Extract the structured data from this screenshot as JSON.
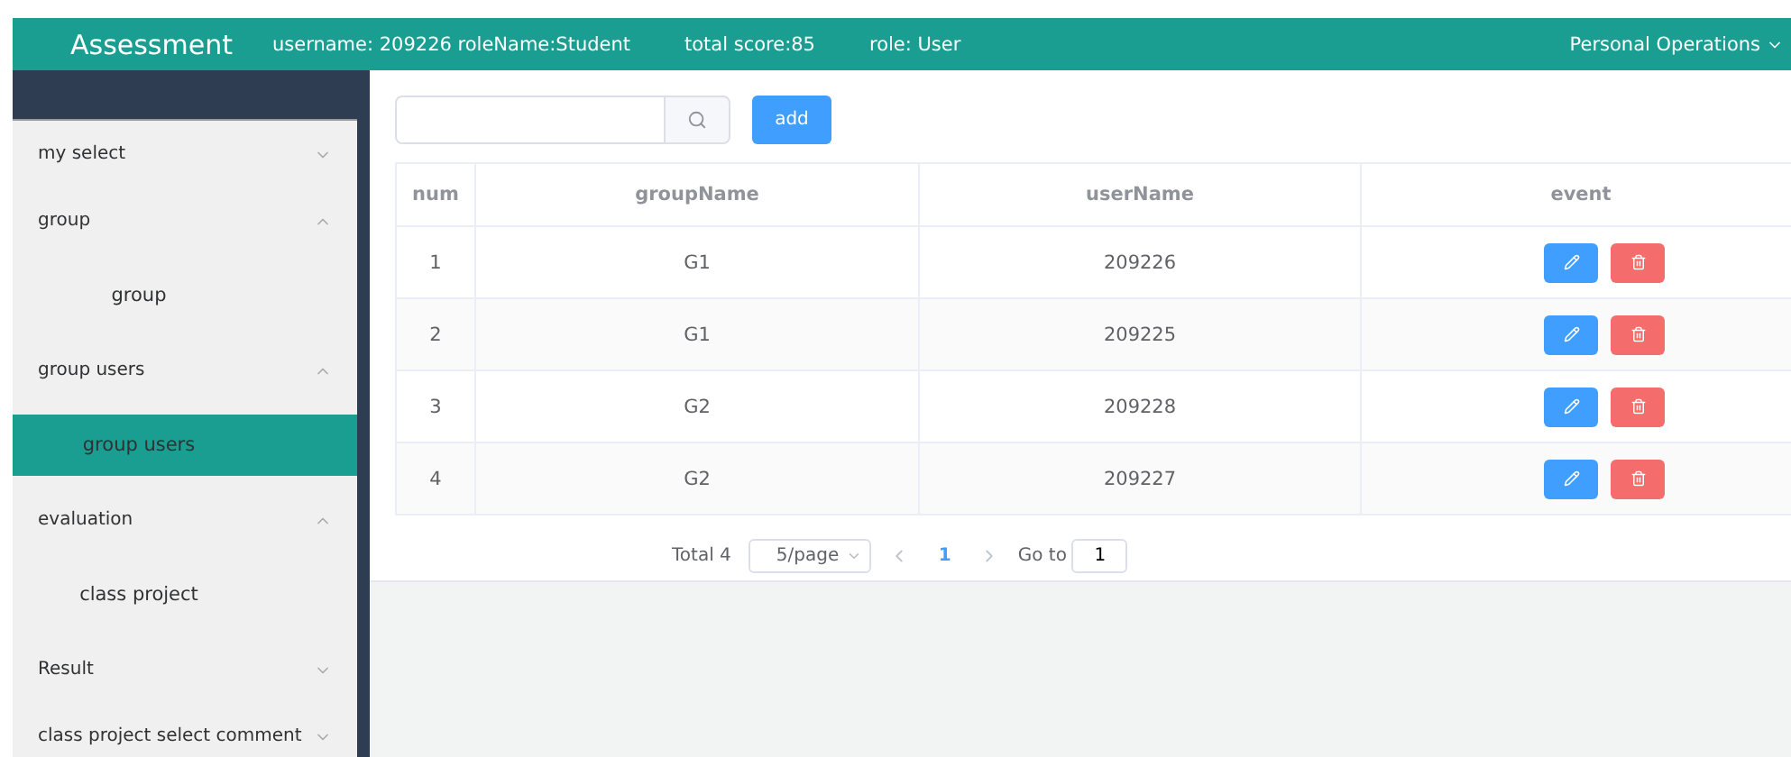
{
  "header": {
    "title": "Assessment",
    "info": [
      "username: 209226 roleName:Student",
      "total score:85",
      "role: User"
    ],
    "menu": "Personal Operations"
  },
  "sidebar": {
    "items": [
      {
        "label": "my select",
        "expanded": false
      },
      {
        "label": "group",
        "expanded": true,
        "children": [
          {
            "label": "group",
            "selected": false
          }
        ]
      },
      {
        "label": "group users",
        "expanded": true,
        "children": [
          {
            "label": "group users",
            "selected": true
          }
        ]
      },
      {
        "label": "evaluation",
        "expanded": true,
        "children": [
          {
            "label": "class project",
            "selected": false
          }
        ]
      },
      {
        "label": "Result",
        "expanded": false
      },
      {
        "label": "class project select comment",
        "expanded": false
      }
    ]
  },
  "toolbar": {
    "add_button": "add"
  },
  "table": {
    "columns": [
      "num",
      "groupName",
      "userName",
      "event"
    ],
    "rows": [
      {
        "num": "1",
        "groupName": "G1",
        "userName": "209226"
      },
      {
        "num": "2",
        "groupName": "G1",
        "userName": "209225"
      },
      {
        "num": "3",
        "groupName": "G2",
        "userName": "209228"
      },
      {
        "num": "4",
        "groupName": "G2",
        "userName": "209227"
      }
    ]
  },
  "pagination": {
    "total": "Total 4",
    "page_size": "5/page",
    "pages": [
      {
        "label": "1",
        "selected": true
      }
    ],
    "goto_label": "Go to",
    "goto_value": "1"
  }
}
